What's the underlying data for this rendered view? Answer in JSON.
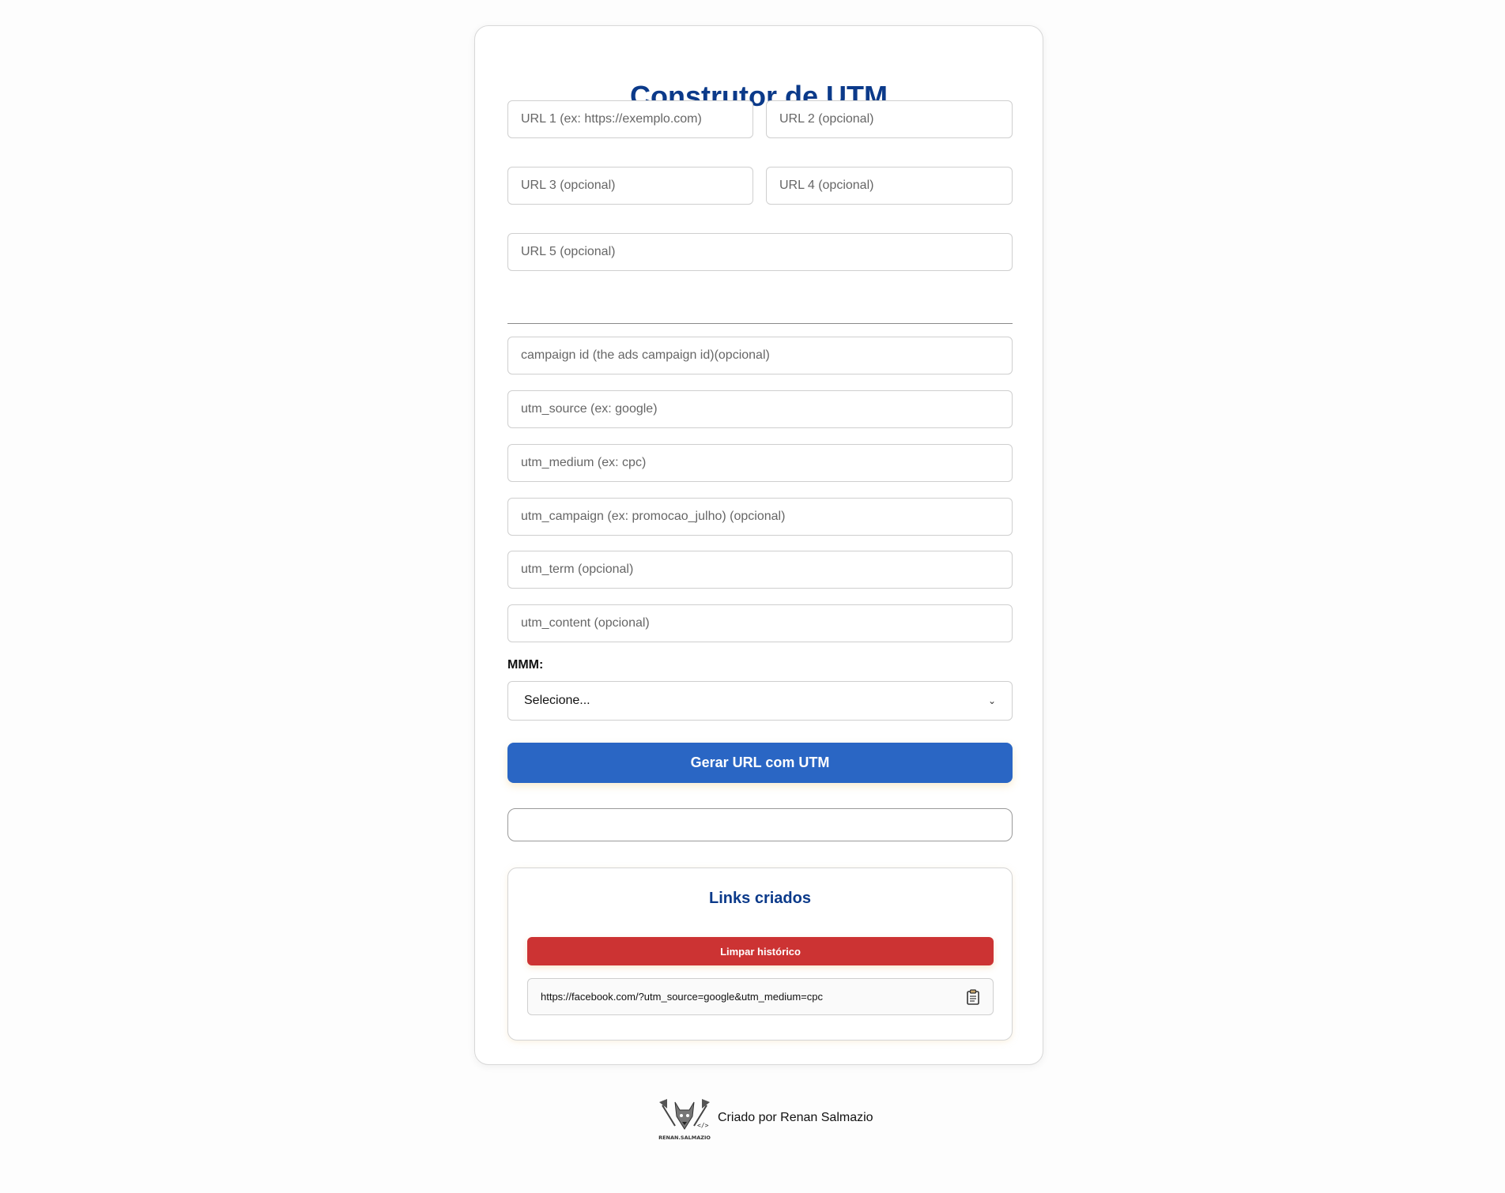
{
  "title": "Construtor de UTM",
  "urls": {
    "url1_placeholder": "URL 1 (ex: https://exemplo.com)",
    "url2_placeholder": "URL 2 (opcional)",
    "url3_placeholder": "URL 3 (opcional)",
    "url4_placeholder": "URL 4 (opcional)",
    "url5_placeholder": "URL 5 (opcional)"
  },
  "params": {
    "campaign_id_placeholder": "campaign id (the ads campaign id)(opcional)",
    "utm_source_placeholder": "utm_source (ex: google)",
    "utm_medium_placeholder": "utm_medium (ex: cpc)",
    "utm_campaign_placeholder": "utm_campaign (ex: promocao_julho) (opcional)",
    "utm_term_placeholder": "utm_term (opcional)",
    "utm_content_placeholder": "utm_content (opcional)"
  },
  "mmm": {
    "label": "MMM:",
    "selected": "Selecione..."
  },
  "generate_button": "Gerar URL com UTM",
  "history": {
    "title": "Links criados",
    "clear_button": "Limpar histórico",
    "links": [
      "https://facebook.com/?utm_source=google&utm_medium=cpc"
    ]
  },
  "footer": {
    "text": "Criado por Renan Salmazio",
    "logo_text": "RENAN.SALMAZIO"
  },
  "colors": {
    "title": "#0b3a8a",
    "primary_button": "#2a66c4",
    "danger_button": "#cc3333"
  }
}
